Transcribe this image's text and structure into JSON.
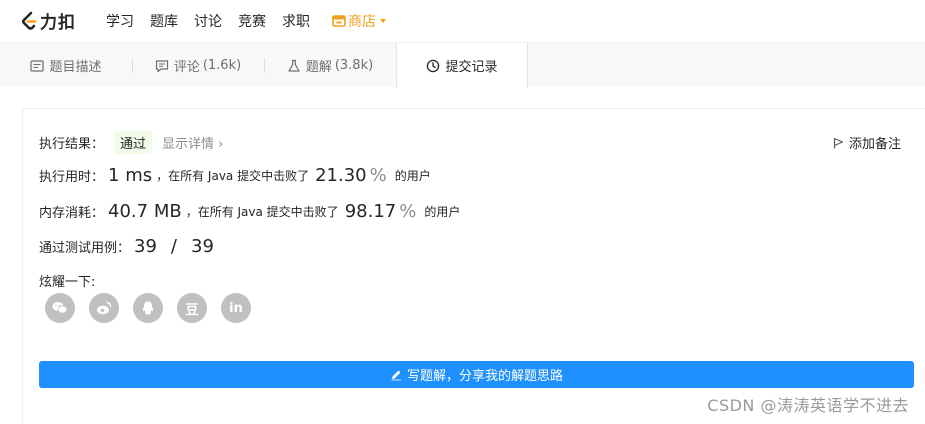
{
  "nav": {
    "logo_text": "力扣",
    "items": [
      "学习",
      "题库",
      "讨论",
      "竞赛",
      "求职"
    ],
    "shop": "商店"
  },
  "tabs": [
    {
      "label": "题目描述",
      "count": "",
      "icon": "description-icon"
    },
    {
      "label": "评论",
      "count": "(1.6k)",
      "icon": "comment-icon"
    },
    {
      "label": "题解",
      "count": "(3.8k)",
      "icon": "flask-icon"
    },
    {
      "label": "提交记录",
      "count": "",
      "icon": "clock-icon",
      "active": true
    }
  ],
  "result": {
    "label": "执行结果：",
    "status": "通过",
    "detail_link": "显示详情 ›",
    "note": "添加备注"
  },
  "runtime": {
    "label": "执行用时：",
    "value": "1 ms",
    "prefix": "，在所有 Java 提交中击败了",
    "percent": "21.30",
    "suffix": "的用户"
  },
  "memory": {
    "label": "内存消耗：",
    "value": "40.7 MB",
    "prefix": "，在所有 Java 提交中击败了",
    "percent": "98.17",
    "suffix": "的用户"
  },
  "tests": {
    "label": "通过测试用例：",
    "passed": "39",
    "total": "39"
  },
  "share": {
    "label": "炫耀一下:",
    "platforms": [
      "wechat-icon",
      "weibo-icon",
      "qq-icon",
      "douban-icon",
      "linkedin-icon"
    ],
    "douban_glyph": "豆",
    "linkedin_glyph": "in"
  },
  "write_button": "写题解，分享我的解题思路",
  "watermark": "CSDN @涛涛英语学不进去"
}
